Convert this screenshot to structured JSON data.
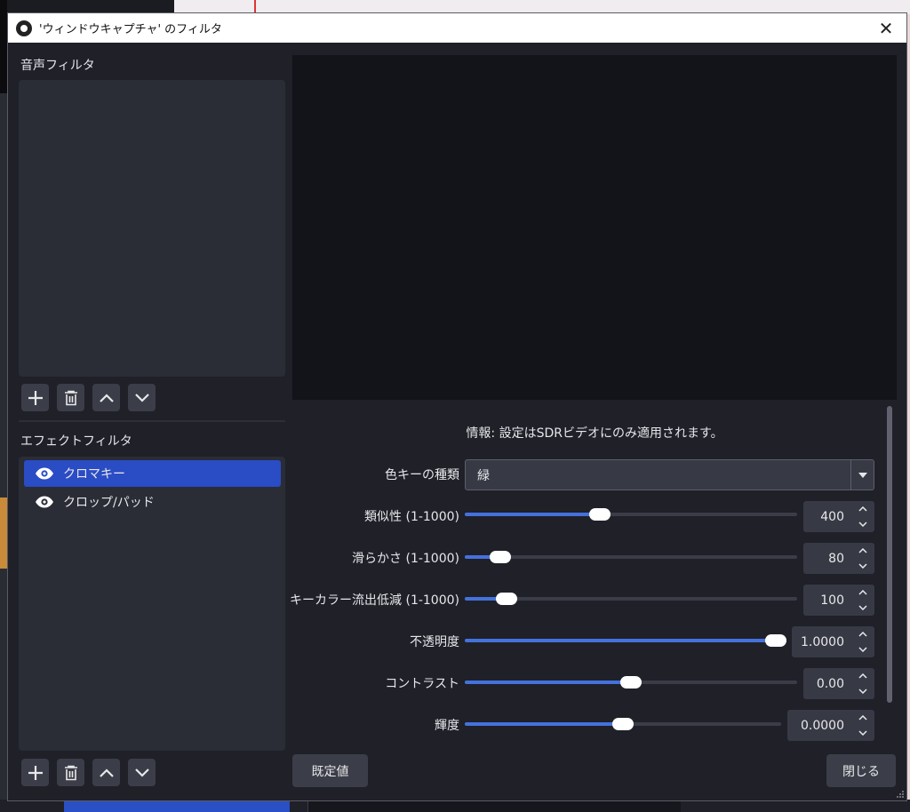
{
  "window": {
    "title": "'ウィンドウキャプチャ' のフィルタ",
    "close_glyph": "✕"
  },
  "audio_filters": {
    "label": "音声フィルタ",
    "items": []
  },
  "effect_filters": {
    "label": "エフェクトフィルタ",
    "items": [
      {
        "label": "クロマキー",
        "selected": true,
        "visible": true
      },
      {
        "label": "クロップ/パッド",
        "selected": false,
        "visible": true
      }
    ]
  },
  "toolbar_icons": [
    "plus-icon",
    "trash-icon",
    "chevron-up-icon",
    "chevron-down-icon"
  ],
  "properties": {
    "info": "情報: 設定はSDRビデオにのみ適用されます。",
    "key_type": {
      "label": "色キーの種類",
      "value": "緑"
    },
    "similarity": {
      "label": "類似性 (1-1000)",
      "value": "400",
      "fraction": 0.4
    },
    "smoothness": {
      "label": "滑らかさ (1-1000)",
      "value": "80",
      "fraction": 0.08
    },
    "spill": {
      "label": "キーカラー流出低減 (1-1000)",
      "value": "100",
      "fraction": 0.1
    },
    "opacity": {
      "label": "不透明度",
      "value": "1.0000",
      "fraction": 1.0
    },
    "contrast": {
      "label": "コントラスト",
      "value": "0.00",
      "fraction": 0.5
    },
    "brightness": {
      "label": "輝度",
      "value": "0.0000",
      "fraction": 0.5
    }
  },
  "buttons": {
    "defaults": "既定値",
    "close": "閉じる"
  },
  "colors": {
    "accent": "#4472dd",
    "selection": "#2a4cc4",
    "background": "#1f2028"
  }
}
